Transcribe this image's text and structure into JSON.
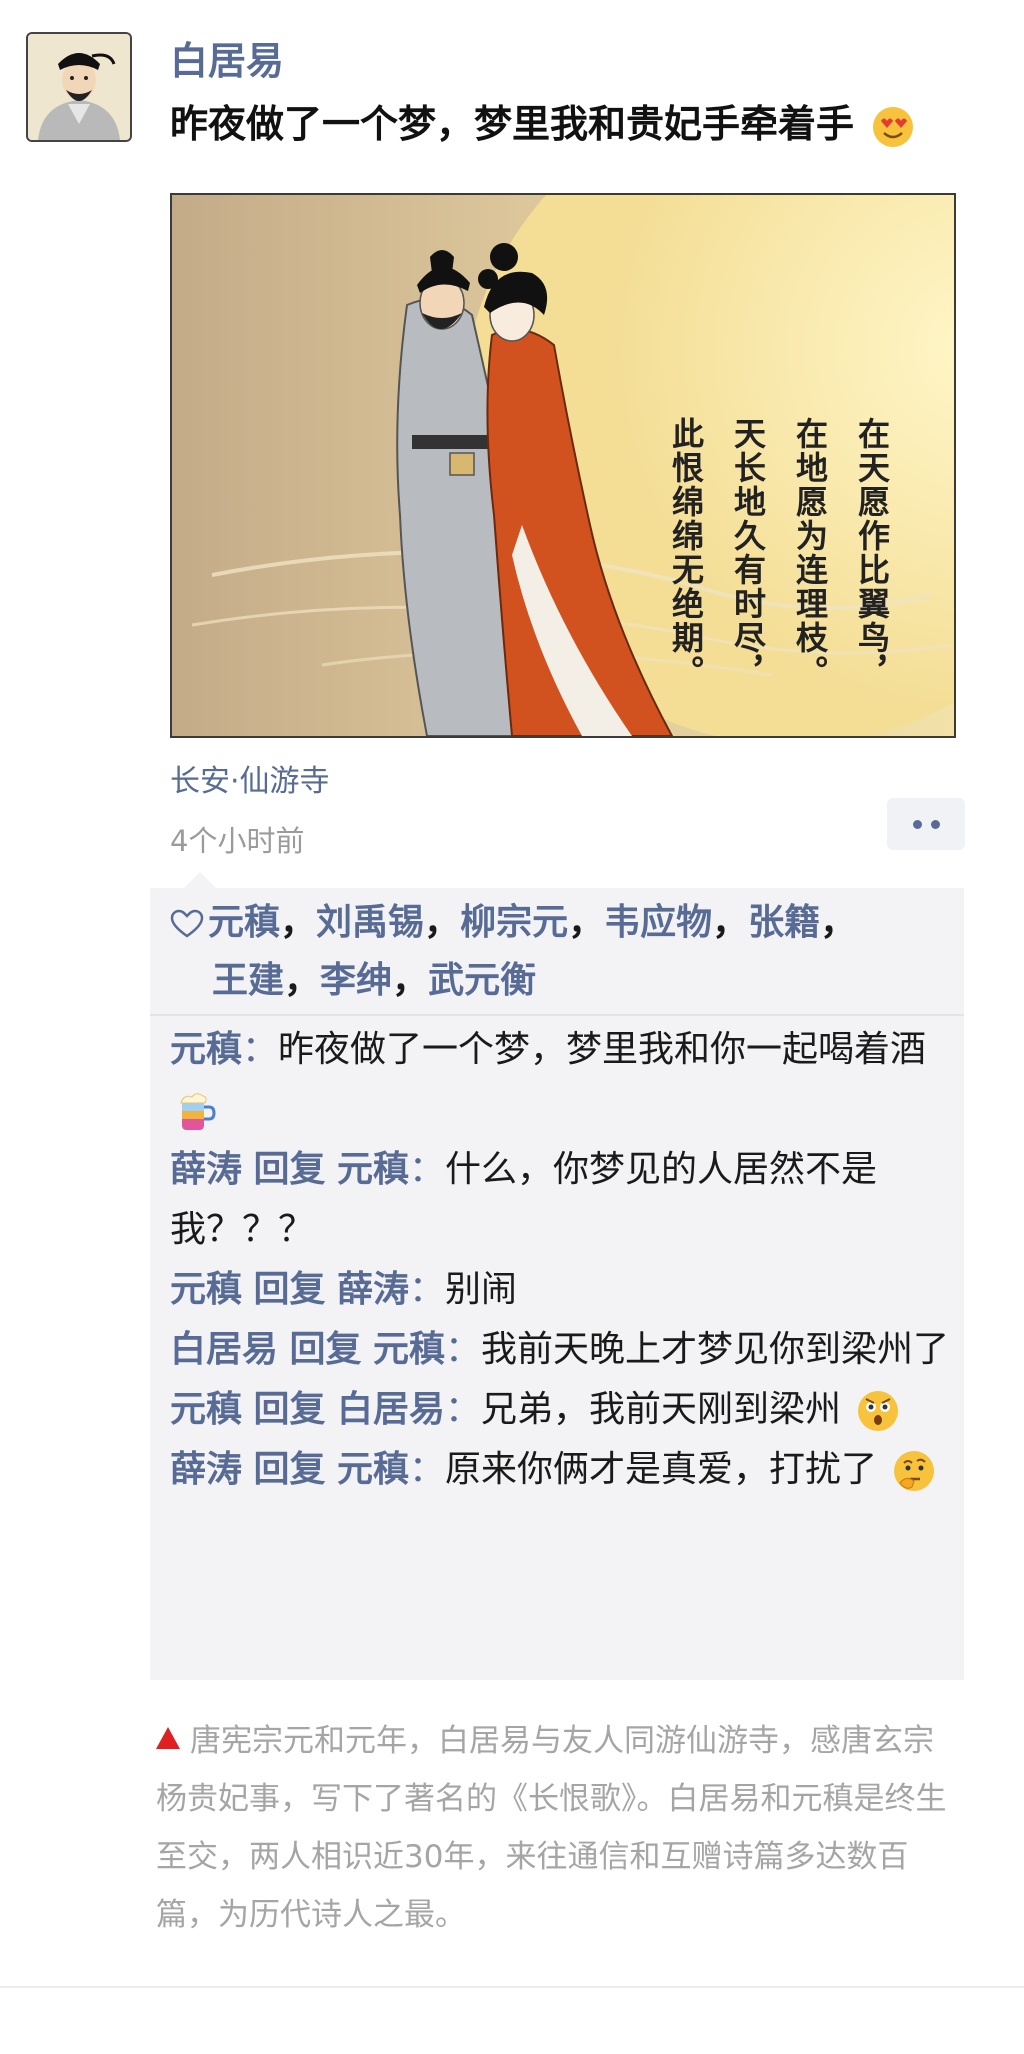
{
  "post": {
    "author": "白居易",
    "text": "昨夜做了一个梦，梦里我和贵妃手牵着手",
    "text_emoji": "heart-eyes-emoji",
    "location": "长安·仙游寺",
    "time": "4个小时前"
  },
  "image": {
    "poem_columns": [
      "在天愿作比翼鸟，",
      "在地愿为连理枝。",
      "天长地久有时尽，",
      "此恨绵绵无绝期。"
    ]
  },
  "likes": {
    "names": [
      "元稹",
      "刘禹锡",
      "柳宗元",
      "韦应物",
      "张籍",
      "王建",
      "李绅",
      "武元衡"
    ]
  },
  "comments": [
    {
      "name": "元稹",
      "reply_label": "",
      "reply_to": "",
      "text": "昨夜做了一个梦，梦里我和你一起喝着酒",
      "emoji": "beer-mug-emoji"
    },
    {
      "name": "薛涛",
      "reply_label": "回复",
      "reply_to": "元稹",
      "text": "什么，你梦见的人居然不是我？？？",
      "emoji": ""
    },
    {
      "name": "元稹",
      "reply_label": "回复",
      "reply_to": "薛涛",
      "text": "别闹",
      "emoji": ""
    },
    {
      "name": "白居易",
      "reply_label": "回复",
      "reply_to": "元稹",
      "text": "我前天晚上才梦见你到梁州了",
      "emoji": ""
    },
    {
      "name": "元稹",
      "reply_label": "回复",
      "reply_to": "白居易",
      "text": "兄弟，我前天刚到梁州",
      "emoji": "astonished-emoji"
    },
    {
      "name": "薛涛",
      "reply_label": "回复",
      "reply_to": "元稹",
      "text": "原来你俩才是真爱，打扰了",
      "emoji": "thinking-emoji"
    }
  ],
  "caption": "唐宪宗元和元年，白居易与友人同游仙游寺，感唐玄宗杨贵妃事，写下了著名的《长恨歌》。白居易和元稹是终生至交，两人相识近30年，来往通信和互赠诗篇多达数百篇，为历代诗人之最。",
  "colors": {
    "name_blue": "#576b95",
    "caption_gray": "#a5a5a5",
    "comment_bg": "#f3f3f5",
    "alert_red": "#e02020"
  }
}
